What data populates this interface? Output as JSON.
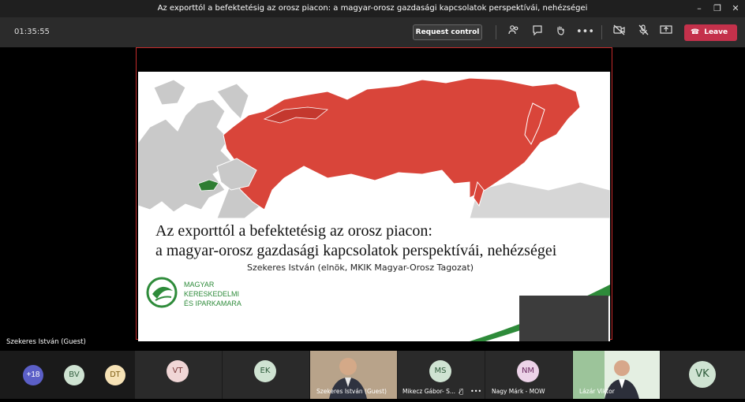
{
  "window": {
    "title": "Az exporttól a befektetésig az orosz piacon: a magyar-orosz gazdasági kapcsolatok perspektívái, nehézségei"
  },
  "toolbar": {
    "timer": "01:35:55",
    "request_control": "Request control",
    "leave": "Leave",
    "accent": "#c4314b"
  },
  "slide": {
    "title_line1": "Az exporttól a befektetésig az orosz piacon:",
    "title_line2": "a magyar-orosz gazdasági kapcsolatok perspektívái, nehézségei",
    "subtitle": "Szekeres István (elnök, MKIK Magyar-Orosz Tagozat)",
    "logo_lines": [
      "MAGYAR",
      "KERESKEDELMI",
      "ÉS IPARKAMARA"
    ],
    "russia_color": "#d9453a",
    "hungary_color": "#2e7d32"
  },
  "speaker_name": "Szekeres István (Guest)",
  "participants": {
    "overflow": "+18",
    "avatars": [
      {
        "initials": "BV",
        "bg": "#cfe3d2",
        "fg": "#2d5a3a"
      },
      {
        "initials": "DT",
        "bg": "#f6e2b6",
        "fg": "#7a5a10"
      },
      {
        "initials": "VT",
        "bg": "#f0d6d6",
        "fg": "#7a3a3a"
      },
      {
        "initials": "EK",
        "bg": "#cfe3d2",
        "fg": "#2d5a3a"
      },
      {
        "initials": "MS",
        "bg": "#cfe3d2",
        "fg": "#2d5a3a"
      },
      {
        "initials": "NM",
        "bg": "#ecd3e8",
        "fg": "#6a2a60"
      },
      {
        "initials": "VK",
        "bg": "#cfe3d2",
        "fg": "#2d5a3a"
      }
    ],
    "tiles": [
      {
        "name": "Szekeres István (Guest)"
      },
      {
        "name": "Mikecz Gábor- S..."
      },
      {
        "name": "Nagy Márk - MOW"
      },
      {
        "name": "Lázár Viktor"
      }
    ]
  }
}
